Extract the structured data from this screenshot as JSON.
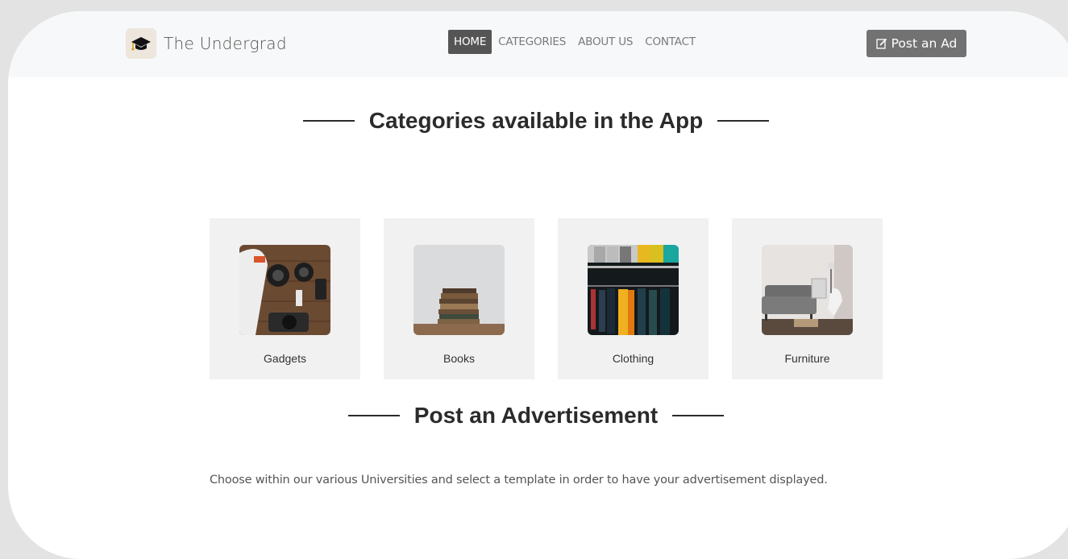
{
  "brand": {
    "name": "The Undergrad",
    "icon": "graduation-cap-icon"
  },
  "nav": {
    "items": [
      {
        "label": "HOME",
        "active": true
      },
      {
        "label": "CATEGORIES",
        "active": false
      },
      {
        "label": "ABOUT US",
        "active": false
      },
      {
        "label": "CONTACT",
        "active": false
      }
    ],
    "post_button": "Post an Ad"
  },
  "categories_section": {
    "title": "Categories available in the App"
  },
  "categories": [
    {
      "label": "Gadgets",
      "image": "gadgets-photo"
    },
    {
      "label": "Books",
      "image": "books-photo"
    },
    {
      "label": "Clothing",
      "image": "clothing-photo"
    },
    {
      "label": "Furniture",
      "image": "furniture-photo"
    }
  ],
  "advert_section": {
    "title": "Post an Advertisement",
    "description": "Choose within our various Universities and select a template in order to have your advertisement displayed."
  },
  "colors": {
    "active_nav": "#555555",
    "post_button": "#727272",
    "card_bg": "#f1f1f1",
    "navbar_bg": "#f7f8f9"
  }
}
